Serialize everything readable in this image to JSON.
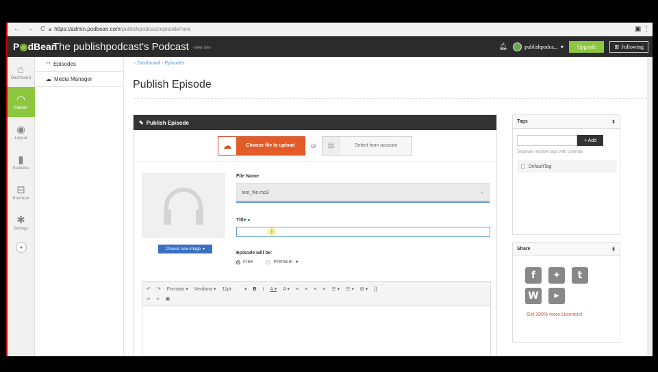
{
  "browser": {
    "url_host": "https://admin.podbean.com",
    "url_path": "/publishpodcast/episode/new"
  },
  "header": {
    "logo_pod": "P",
    "logo_rest": "dBean",
    "title": "The publishpodcast's Podcast",
    "view_site": "- view site ›",
    "account": "publishpodca...",
    "upgrade": "Upgrade",
    "following": "Following"
  },
  "sidebar": {
    "items": [
      {
        "label": "Dashboard",
        "icon": "home-icon"
      },
      {
        "label": "Publish",
        "icon": "broadcast-icon"
      },
      {
        "label": "Layout",
        "icon": "eye-icon"
      },
      {
        "label": "Statistics",
        "icon": "bar-chart-icon"
      },
      {
        "label": "Premium",
        "icon": "cart-icon"
      },
      {
        "label": "Settings",
        "icon": "gear-icon"
      }
    ],
    "active": "Publish"
  },
  "subnav": {
    "episodes": "Episodes",
    "media_manager": "Media Manager"
  },
  "breadcrumb": {
    "dashboard": "Dashboard",
    "separator": "›",
    "episodes": "Episodes"
  },
  "page": {
    "title": "Publish Episode"
  },
  "publish": {
    "panel_title": "Publish Episode",
    "choose_file": "Choose file to upload",
    "or": "or",
    "select_account": "Select from account",
    "choose_image": "Choose new image",
    "file_name_label": "File Name",
    "file_name_value": "test_file.mp3",
    "title_label": "Title",
    "title_value": "",
    "episode_will_be": "Episode will be:",
    "free": "Free",
    "premium": "Premium",
    "visibility_selected": "Free"
  },
  "editor": {
    "formats": "Formats",
    "font": "Verdana",
    "size": "11pt"
  },
  "tags": {
    "title": "Tags",
    "add": "+ Add",
    "hint": "Separate multiple tags with commas",
    "default_tag": "DefaultTag"
  },
  "share": {
    "title": "Share",
    "cta": "Get 300% more Listeners!",
    "networks": [
      "facebook-icon",
      "twitter-icon",
      "tumblr-icon",
      "wordpress-icon",
      "youtube-icon"
    ]
  },
  "colors": {
    "brand_green": "#8dc63f",
    "upload_orange": "#e35b27",
    "link_blue": "#5b8fc9",
    "dark_header": "#2b2b2b"
  }
}
